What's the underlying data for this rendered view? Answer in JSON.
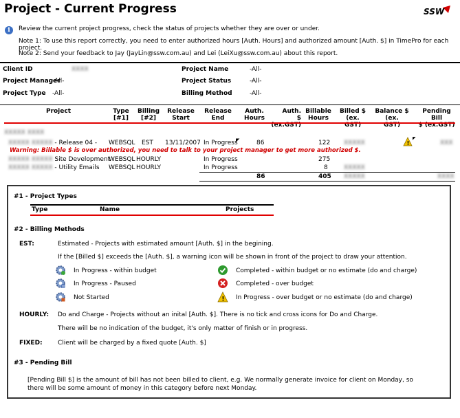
{
  "header": {
    "title": "Project - Current Progress",
    "logo_text": "SSW",
    "intro": "Review the current project progress, check the status of projects whether they are over or under.",
    "note1": "Note 1: To use this report correctly, you need to enter authorized hours [Auth. Hours] and authorized amount [Auth. $] in TimePro for each project.",
    "note2": "Note 2: Send your feedback to Jay (JayLin@ssw.com.au) and Lei (LeiXu@ssw.com.au) about this report."
  },
  "filters": {
    "client_id_label": "Client ID",
    "client_id_value": "XXXX",
    "project_manager_label": "Project Manager",
    "project_manager_value": "-All-",
    "project_type_label": "Project Type",
    "project_type_value": "-All-",
    "project_name_label": "Project Name",
    "project_name_value": "-All-",
    "project_status_label": "Project Status",
    "project_status_value": "-All-",
    "billing_method_label": "Billing Method",
    "billing_method_value": "-All-"
  },
  "table": {
    "headers": {
      "project": "Project",
      "type": "Type\n[#1]",
      "billing": "Billing\n[#2]",
      "release_start": "Release\nStart",
      "release_end": "Release\nEnd",
      "auth_hours": "Auth.\nHours",
      "auth_amount": "Auth.\n$ (ex.GST)",
      "billable_hours": "Billable\nHours",
      "billed": "Billed $\n(ex. GST)",
      "balance": "Balance $ (ex.\nGST)",
      "pending": "Pending Bill\n$ (ex.GST)"
    },
    "client_name": "XXXXX XXXX",
    "rows": [
      {
        "project": "- Release 04 -",
        "blurred": "XXXXX XXXXX",
        "type": "WEBSQL",
        "billing": "EST",
        "start": "13/11/2007",
        "end": "In Progress",
        "auth_hours": "86",
        "billable": "122",
        "billed": "XXXXX",
        "pending": "XXX"
      },
      {
        "project": "Site Development",
        "blurred": "XXXXX XXXXX",
        "type": "WEBSQL",
        "billing": "HOURLY",
        "start": "",
        "end": "In Progress",
        "auth_hours": "",
        "billable": "275",
        "billed": "",
        "pending": ""
      },
      {
        "project": "- Utility Emails",
        "blurred": "XXXXX XXXXX",
        "type": "WEBSQL",
        "billing": "HOURLY",
        "start": "",
        "end": "In Progress",
        "auth_hours": "",
        "billable": "8",
        "billed": "XXXXX",
        "pending": ""
      }
    ],
    "warning": "Warning: Billable $ is over authorized, you need to talk to your project manager to get more authorized $.",
    "totals": {
      "auth_hours": "86",
      "billable": "405",
      "billed": "XXXXX",
      "pending": "XXXX"
    }
  },
  "legend": {
    "project_types_title": "#1 - Project Types",
    "pt_type": "Type",
    "pt_name": "Name",
    "pt_projects": "Projects",
    "billing_title": "#2 - Billing Methods",
    "est_label": "EST:",
    "est_desc": "Estimated - Projects with estimated amount [Auth. $] in the begining.",
    "est_warning": "If the [Billed $] exceeds the [Auth. $], a warning icon will be shown in front of the project to draw your attention.",
    "icons": [
      {
        "icon": "gear-progress-icon",
        "label": "In Progress - within budget"
      },
      {
        "icon": "gear-paused-icon",
        "label": "In Progress - Paused"
      },
      {
        "icon": "gear-notstarted-icon",
        "label": "Not Started"
      },
      {
        "icon": "check-icon",
        "label": "Completed - within budget or no estimate (do and charge)"
      },
      {
        "icon": "cross-icon",
        "label": "Completed - over budget"
      },
      {
        "icon": "warning-icon",
        "label": "In Progress - over budget or no estimate (do and charge)"
      }
    ],
    "hourly_label": "HOURLY:",
    "hourly_desc": "Do and Charge - Projects without an inital [Auth. $]. There is no tick and cross icons for Do and Charge.",
    "hourly_desc2": "There will be no indication of the budget, it's only matter of finish or in progress.",
    "fixed_label": "FIXED:",
    "fixed_desc": "Client will be charged by a fixed quote [Auth. $]",
    "pending_title": "#3 - Pending Bill",
    "pending_desc1": "[Pending Bill $] is the amount of bill has not been billed to client, e.g. We normally generate invoice for client on Monday, so",
    "pending_desc2": "there will be some amount of money in this category before next Monday."
  },
  "colors": {
    "accent_red": "#e00000",
    "check": "#2e9a2e",
    "cross": "#d42020",
    "warning": "#f2c200"
  }
}
